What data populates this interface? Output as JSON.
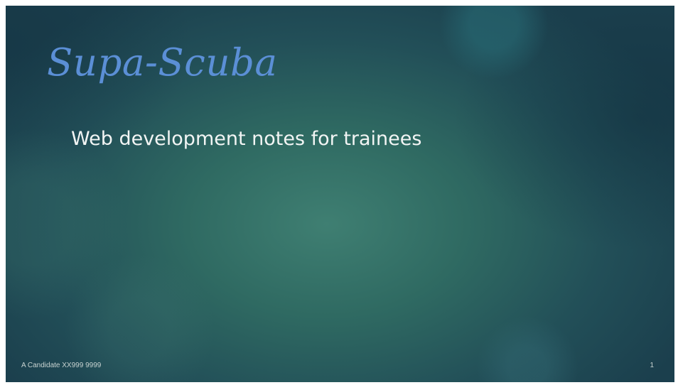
{
  "slide": {
    "title": "Supa-Scuba",
    "subtitle": "Web development notes for trainees",
    "footer": "A Candidate XX999 9999",
    "page_number": "1"
  },
  "colors": {
    "title": "#5b8fd6",
    "subtitle": "#f2f5f4",
    "background_center": "#3f7f72",
    "background_edge": "#1b3f4d"
  }
}
